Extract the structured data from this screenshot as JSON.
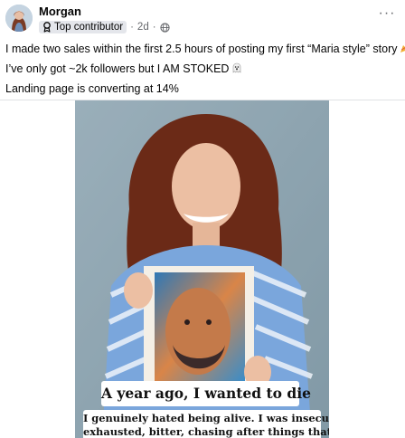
{
  "post": {
    "author": "Morgan",
    "badge": "Top contributor",
    "separator": "·",
    "time": "2d",
    "privacy_icon": "globe-icon",
    "more_icon": "more-options-icon",
    "more_label": "···"
  },
  "body": {
    "line1": "I made two sales within the first 2.5 hours of posting my first “Maria style” story",
    "line1_emoji": "party-popper",
    "line2": "I’ve only got ~2k followers but I AM STOKED",
    "line2_emoji": "ghost",
    "line3": "Landing page is converting at 14%"
  },
  "media": {
    "caption_headline": "A year ago, I wanted to die",
    "caption_line1": "I genuinely hated being alive. I was insecure,",
    "caption_line2": "exhausted, bitter, chasing after things that"
  },
  "colors": {
    "text": "#050505",
    "secondary": "#65676b",
    "badge_bg": "#e4e6eb",
    "divider": "#dfe1e5"
  }
}
